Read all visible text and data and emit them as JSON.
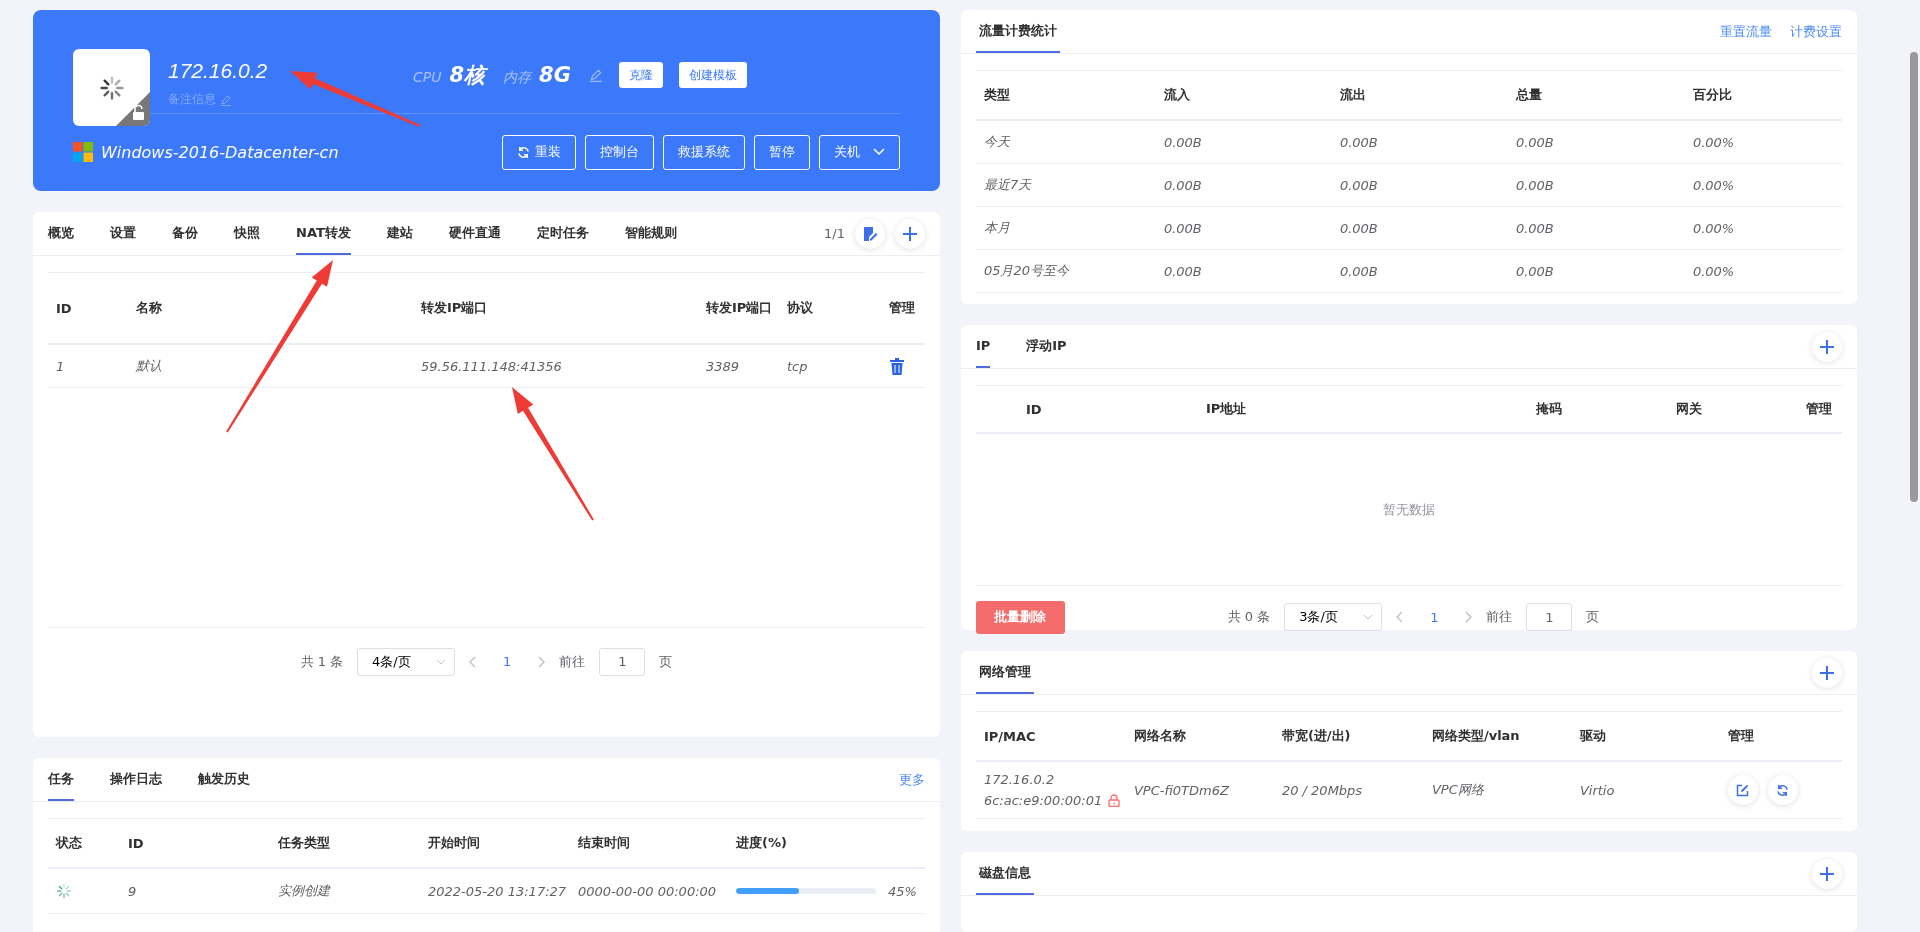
{
  "header": {
    "ip": "172.16.0.2",
    "note": "备注信息",
    "cpu_label": "CPU",
    "cpu": "8核",
    "mem_label": "内存",
    "mem": "8G",
    "top_buttons": [
      "克隆",
      "创建模板"
    ],
    "os": "Windows-2016-Datacenter-cn",
    "actions": [
      {
        "label": "重装",
        "kind": "refresh"
      },
      {
        "label": "控制台",
        "kind": "plain"
      },
      {
        "label": "救援系统",
        "kind": "plain"
      },
      {
        "label": "暂停",
        "kind": "plain"
      },
      {
        "label": "关机",
        "kind": "dropdown"
      }
    ]
  },
  "detail": {
    "tabs": [
      {
        "label": "概览",
        "selected": false
      },
      {
        "label": "设置",
        "selected": false
      },
      {
        "label": "备份",
        "selected": false
      },
      {
        "label": "快照",
        "selected": false
      },
      {
        "label": "NAT转发",
        "selected": true
      },
      {
        "label": "建站",
        "selected": false
      },
      {
        "label": "硬件直通",
        "selected": false
      },
      {
        "label": "定时任务",
        "selected": false
      },
      {
        "label": "智能规则",
        "selected": false
      }
    ],
    "page": "1/1",
    "columns": [
      "ID",
      "名称",
      "转发IP端口",
      "转发IP端口",
      "协议",
      "管理"
    ],
    "rows": [
      {
        "cells": [
          "1",
          "默认",
          "59.56.111.148:41356",
          "3389",
          "tcp"
        ]
      }
    ],
    "pagination": {
      "total": "共 1 条",
      "page_size": "4条/页",
      "page": "1",
      "goto_label": "前往",
      "goto_value": "1",
      "goto_suffix": "页"
    }
  },
  "tasks": {
    "tabs": [
      {
        "label": "任务",
        "selected": true
      },
      {
        "label": "操作日志",
        "selected": false
      },
      {
        "label": "触发历史",
        "selected": false
      }
    ],
    "more": "更多",
    "columns": [
      "状态",
      "ID",
      "任务类型",
      "开始时间",
      "结束时间",
      "进度(%)"
    ],
    "rows": [
      {
        "id": "9",
        "type": "实例创建",
        "start": "2022-05-20 13:17:27",
        "end": "0000-00-00 00:00:00",
        "level": 0.45,
        "reading": "45%"
      }
    ]
  },
  "traffic": {
    "title": "流量计费统计",
    "links": [
      "重置流量",
      "计费设置"
    ],
    "columns": [
      "类型",
      "流入",
      "流出",
      "总量",
      "百分比"
    ],
    "rows": [
      [
        "今天",
        "0.00B",
        "0.00B",
        "0.00B",
        "0.00%"
      ],
      [
        "最近7天",
        "0.00B",
        "0.00B",
        "0.00B",
        "0.00%"
      ],
      [
        "本月",
        "0.00B",
        "0.00B",
        "0.00B",
        "0.00%"
      ],
      [
        "05月20号至今",
        "0.00B",
        "0.00B",
        "0.00B",
        "0.00%"
      ]
    ]
  },
  "ip": {
    "tabs": [
      {
        "label": "IP",
        "selected": true
      },
      {
        "label": "浮动IP",
        "selected": false
      }
    ],
    "columns": [
      "ID",
      "IP地址",
      "掩码",
      "网关",
      "管理"
    ],
    "empty": "暂无数据",
    "batch_delete": "批量删除",
    "pagination": {
      "total": "共 0 条",
      "page_size": "3条/页",
      "page": "1",
      "goto_label": "前往",
      "goto_value": "1",
      "goto_suffix": "页"
    }
  },
  "network": {
    "title": "网络管理",
    "columns": [
      "IP/MAC",
      "网络名称",
      "带宽(进/出)",
      "网络类型/vlan",
      "驱动",
      "管理"
    ],
    "rows": [
      {
        "ip": "172.16.0.2",
        "mac": "6c:ac:e9:00:00:01",
        "locked": true,
        "name": "VPC-fi0TDm6Z",
        "bandwidth": "20 / 20Mbps",
        "type": "VPC网络",
        "driver": "Virtio"
      }
    ]
  },
  "disk": {
    "title": "磁盘信息"
  }
}
